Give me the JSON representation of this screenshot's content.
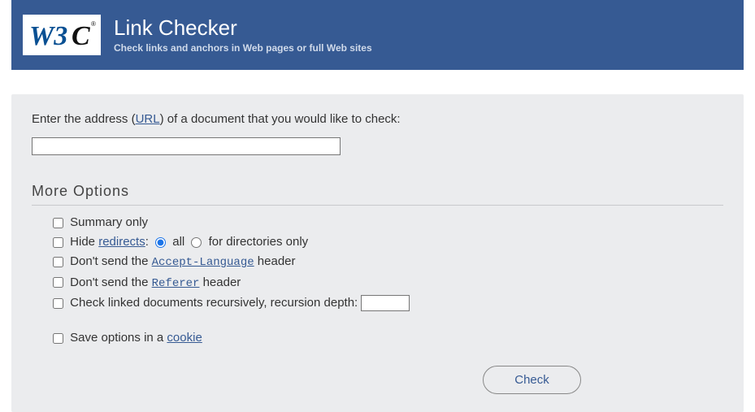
{
  "header": {
    "title": "Link Checker",
    "subtitle": "Check links and anchors in Web pages or full Web sites"
  },
  "prompt": {
    "before_link": "Enter the address (",
    "url_link": "URL",
    "after_link": ") of a document that you would like to check:"
  },
  "url_input": {
    "value": ""
  },
  "more_options_heading": "More Options",
  "options": {
    "summary_only": "Summary only",
    "hide_label": "Hide ",
    "redirects_link": "redirects",
    "hide_colon": ": ",
    "radio_all": "all",
    "radio_dirs": "for directories only",
    "accept_lang_before": "Don't send the ",
    "accept_lang_link": "Accept-Language",
    "accept_lang_after": " header",
    "referer_before": "Don't send the ",
    "referer_link": "Referer",
    "referer_after": " header",
    "recursive_label": "Check linked documents recursively, recursion depth: ",
    "depth_value": "",
    "save_before": "Save options in a ",
    "cookie_link": "cookie"
  },
  "check_button": "Check"
}
